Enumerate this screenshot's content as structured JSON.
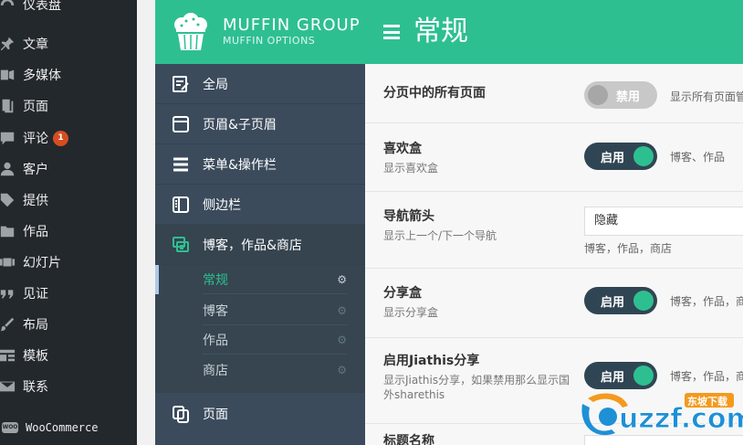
{
  "wp_menu": {
    "items": [
      {
        "label": "仪表盘",
        "icon": "dashboard-icon"
      },
      {
        "label": "文章",
        "icon": "pin-icon"
      },
      {
        "label": "多媒体",
        "icon": "media-icon"
      },
      {
        "label": "页面",
        "icon": "page-icon"
      },
      {
        "label": "评论",
        "icon": "comment-icon",
        "badge": "1"
      },
      {
        "label": "客户",
        "icon": "user-icon"
      },
      {
        "label": "提供",
        "icon": "tag-icon"
      },
      {
        "label": "作品",
        "icon": "folder-icon"
      },
      {
        "label": "幻灯片",
        "icon": "slides-icon"
      },
      {
        "label": "见证",
        "icon": "quote-icon"
      },
      {
        "label": "布局",
        "icon": "brush-icon"
      },
      {
        "label": "模板",
        "icon": "template-icon"
      },
      {
        "label": "联系",
        "icon": "mail-icon"
      }
    ],
    "woo_label": "WooCommerce",
    "woo_icon_text": "WOO"
  },
  "brand": {
    "title": "MUFFIN GROUP",
    "subtitle": "MUFFIN OPTIONS",
    "accent": "#2ebf91"
  },
  "muffin_nav": {
    "items": [
      {
        "label": "全局",
        "icon": "edit-icon"
      },
      {
        "label": "页眉&子页眉",
        "icon": "window-icon"
      },
      {
        "label": "菜单&操作栏",
        "icon": "menu-icon"
      },
      {
        "label": "侧边栏",
        "icon": "sidebar-icon"
      },
      {
        "label": "博客，作品&商店",
        "icon": "blog-icon"
      },
      {
        "label": "页面",
        "icon": "pages-icon"
      }
    ],
    "sub_items": [
      {
        "label": "常规"
      },
      {
        "label": "博客"
      },
      {
        "label": "作品"
      },
      {
        "label": "商店"
      }
    ]
  },
  "page": {
    "title": "常规"
  },
  "settings": [
    {
      "label": "分页中的所有页面",
      "desc": "",
      "control": "toggle",
      "state": "off",
      "toggle_label": "禁用",
      "hint": "显示所有页面管"
    },
    {
      "label": "喜欢盒",
      "desc": "显示喜欢盒",
      "control": "toggle",
      "state": "on",
      "toggle_label": "启用",
      "hint": "博客、作品"
    },
    {
      "label": "导航箭头",
      "desc": "显示上一个/下一个导航",
      "control": "select",
      "value": "隐藏",
      "hint": "博客，作品，商店"
    },
    {
      "label": "分享盒",
      "desc": "显示分享盒",
      "control": "toggle",
      "state": "on",
      "toggle_label": "启用",
      "hint": "博客，作品，商"
    },
    {
      "label": "启用Jiathis分享",
      "desc": "显示Jiathis分享，如果禁用那么显示国外sharethis",
      "control": "toggle",
      "state": "on",
      "toggle_label": "启用",
      "hint": "博客，作品，商"
    },
    {
      "label": "标题名称",
      "desc": "",
      "control": "select",
      "value": ""
    }
  ],
  "watermark": {
    "text": "uzzf.com",
    "tag": "东坡下载"
  }
}
